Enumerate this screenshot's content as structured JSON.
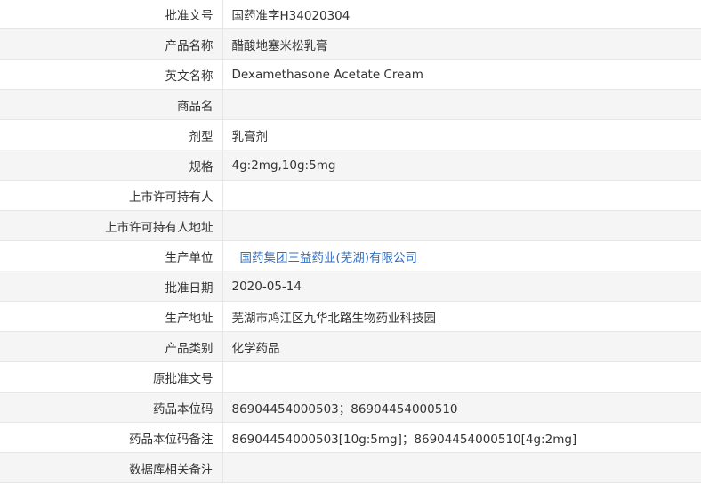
{
  "rows": [
    {
      "label": "批准文号",
      "value": "国药准字H34020304"
    },
    {
      "label": "产品名称",
      "value": "醋酸地塞米松乳膏"
    },
    {
      "label": "英文名称",
      "value": "Dexamethasone Acetate Cream"
    },
    {
      "label": "商品名",
      "value": ""
    },
    {
      "label": "剂型",
      "value": "乳膏剂"
    },
    {
      "label": "规格",
      "value": "4g:2mg,10g:5mg"
    },
    {
      "label": "上市许可持有人",
      "value": ""
    },
    {
      "label": "上市许可持有人地址",
      "value": ""
    },
    {
      "label": "生产单位",
      "value": "国药集团三益药业(芜湖)有限公司"
    },
    {
      "label": "批准日期",
      "value": "2020-05-14"
    },
    {
      "label": "生产地址",
      "value": "芜湖市鸠江区九华北路生物药业科技园"
    },
    {
      "label": "产品类别",
      "value": "化学药品"
    },
    {
      "label": "原批准文号",
      "value": ""
    },
    {
      "label": "药品本位码",
      "value": "86904454000503；86904454000510"
    },
    {
      "label": "药品本位码备注",
      "value": "86904454000503[10g:5mg]；86904454000510[4g:2mg]"
    },
    {
      "label": "数据库相关备注",
      "value": ""
    }
  ],
  "colors": {
    "link": "#2f6fc7",
    "stripe": "#f5f5f5",
    "border": "#e6e6e6"
  }
}
